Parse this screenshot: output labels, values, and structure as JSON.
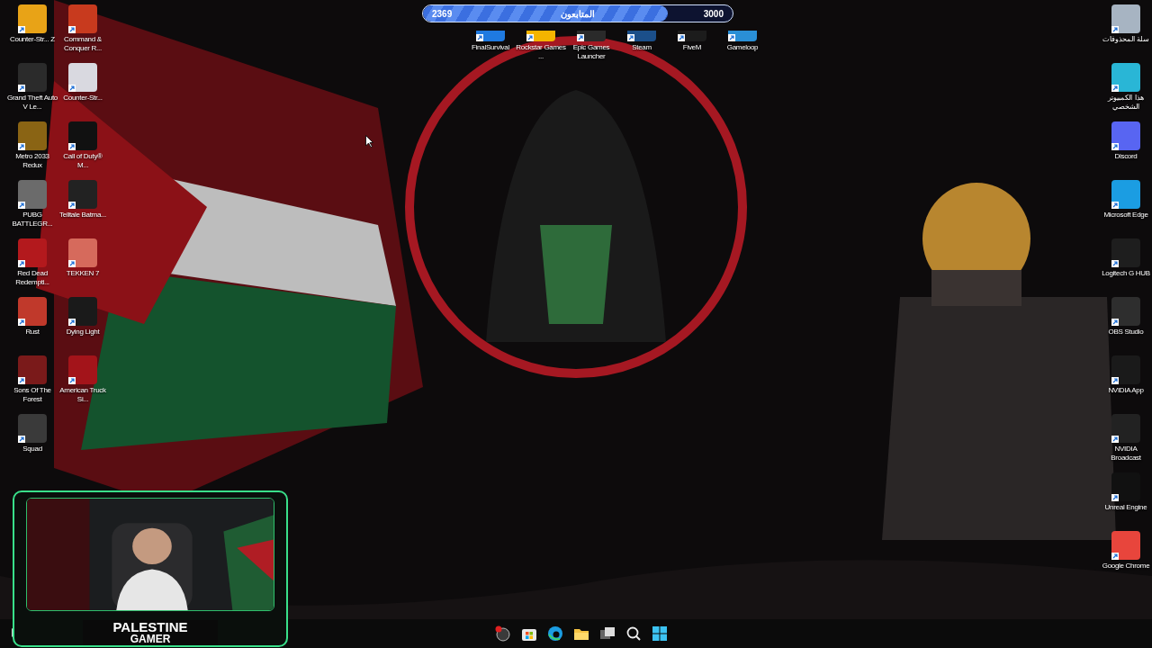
{
  "desktop": {
    "left_columns": [
      [
        {
          "label": "Counter-Str... Z",
          "color": "#e8a317"
        },
        {
          "label": "Grand Theft Auto V Le...",
          "color": "#2b2b2b"
        },
        {
          "label": "Metro 2033 Redux",
          "color": "#8a6414"
        },
        {
          "label": "PUBG BATTLEGR...",
          "color": "#6b6b6b"
        },
        {
          "label": "Red Dead Redempti...",
          "color": "#b3191d"
        },
        {
          "label": "Rust",
          "color": "#c0392b"
        },
        {
          "label": "Sons Of The Forest",
          "color": "#7a1a1a"
        },
        {
          "label": "Squad",
          "color": "#3a3a3a"
        }
      ],
      [
        {
          "label": "Command & Conquer R...",
          "color": "#c83a1e"
        },
        {
          "label": "Counter-Str...",
          "color": "#d9d9e0"
        },
        {
          "label": "Call of Duty® M...",
          "color": "#111111"
        },
        {
          "label": "Telltale Batma...",
          "color": "#222222"
        },
        {
          "label": "TEKKEN 7",
          "color": "#d66a5c"
        },
        {
          "label": "Dying Light",
          "color": "#1a1a1a"
        },
        {
          "label": "American Truck Si...",
          "color": "#a3141a"
        }
      ]
    ],
    "top_row": [
      {
        "label": "FinalSurvival",
        "color": "#1f7ae0"
      },
      {
        "label": "Rockstar Games ...",
        "color": "#f4b400"
      },
      {
        "label": "Epic Games Launcher",
        "color": "#2a2a2a"
      },
      {
        "label": "Steam",
        "color": "#1b4f8a"
      },
      {
        "label": "FiveM",
        "color": "#1c1c1c"
      },
      {
        "label": "Gameloop",
        "color": "#2a8fd6"
      }
    ],
    "right_column": [
      {
        "label": "سلة المحذوفات",
        "color": "#a7b4c2"
      },
      {
        "label": "هذا الكمبيوتر الشخصي",
        "color": "#29b6d6"
      },
      {
        "label": "Discord",
        "color": "#5865f2"
      },
      {
        "label": "Microsoft Edge",
        "color": "#1b9de2"
      },
      {
        "label": "Logitech G HUB",
        "color": "#1e1e1e"
      },
      {
        "label": "OBS Studio",
        "color": "#2e2e2e"
      },
      {
        "label": "NVIDIA App",
        "color": "#1a1a1a"
      },
      {
        "label": "NVIDIA Broadcast",
        "color": "#222222"
      },
      {
        "label": "Unreal Engine",
        "color": "#111111"
      },
      {
        "label": "Google Chrome",
        "color": "#e8453c"
      }
    ]
  },
  "followers_bar": {
    "start": "2369",
    "label": "المتابعون",
    "goal": "3000",
    "level": 0.79
  },
  "webcam": {
    "kind": "picture",
    "banner": [
      "PALESTINE",
      "GAMER"
    ]
  }
}
